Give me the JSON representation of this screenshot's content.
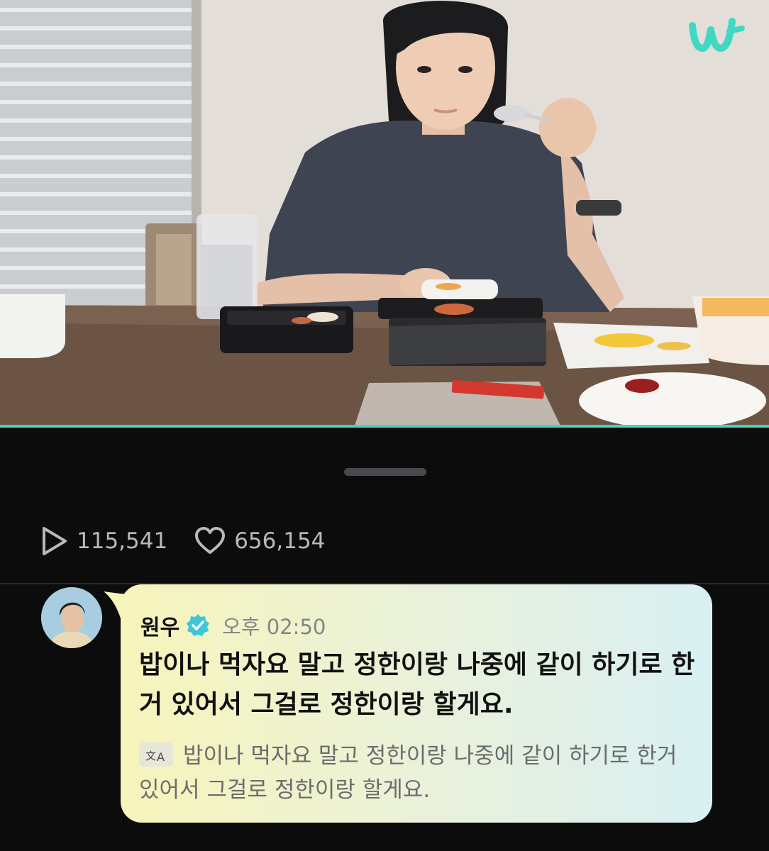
{
  "player": {
    "app_logo": "weverse-logo-icon",
    "progress": 1.0,
    "accent_color": "#41d6bf"
  },
  "stats": {
    "plays_icon": "play-icon",
    "plays": "115,541",
    "likes_icon": "heart-icon",
    "likes": "656,154"
  },
  "comment": {
    "author": "원우",
    "verified_icon": "verified-badge-icon",
    "time": "오후 02:50",
    "message": "밥이나 먹자요 말고 정한이랑 나중에 같이 하기로 한거 있어서 그걸로 정한이랑 할게요.",
    "translate_icon": "translate-icon",
    "translation": "밥이나 먹자요 말고 정한이랑 나중에 같이 하기로 한거 있어서 그걸로 정한이랑 할게요.",
    "bubble_colors": [
      "#f7f4bb",
      "#d8f0f3"
    ]
  }
}
